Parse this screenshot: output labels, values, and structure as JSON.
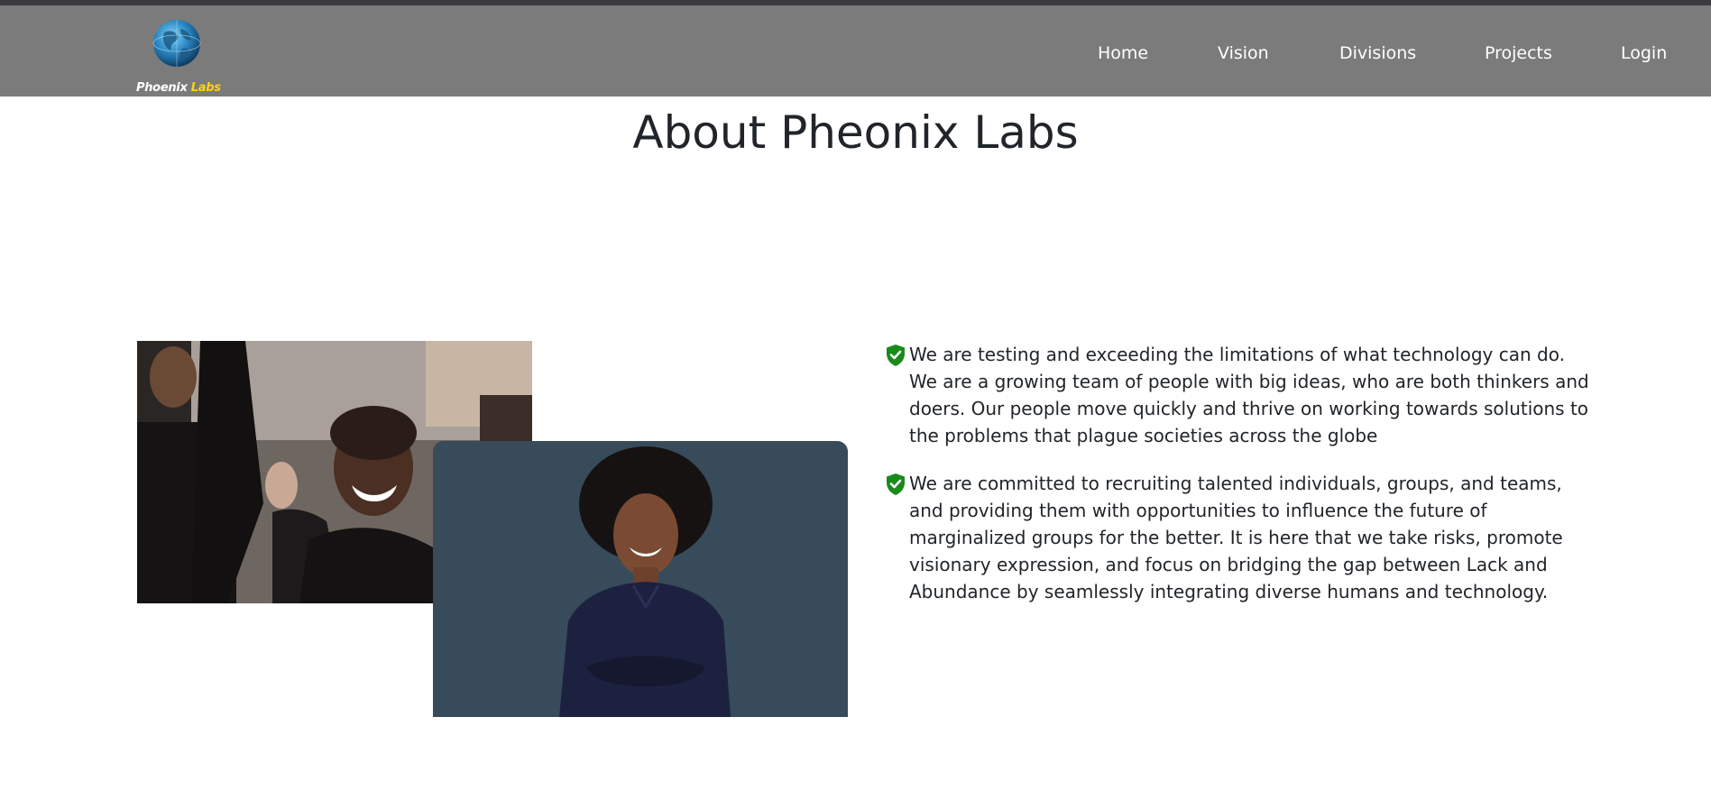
{
  "brand": {
    "name_part1": "Phoenix",
    "name_part2": "Labs",
    "accent": "#ffd400",
    "logo_icon": "globe-icon"
  },
  "nav": {
    "items": [
      {
        "label": "Home"
      },
      {
        "label": "Vision"
      },
      {
        "label": "Divisions"
      },
      {
        "label": "Projects"
      },
      {
        "label": "Login"
      }
    ],
    "background": "#7b7b7b"
  },
  "about": {
    "title": "About Pheonix Labs",
    "images": [
      {
        "name": "crowd-smiling-woman-photo"
      },
      {
        "name": "confident-woman-portrait-photo"
      }
    ],
    "points": [
      {
        "icon": "shield-check-icon",
        "text": "We are testing and exceeding the limitations of what technology can do. We are a growing team of people with big ideas, who are both thinkers and doers. Our people move quickly and thrive on working towards solutions to the problems that plague societies across the globe"
      },
      {
        "icon": "shield-check-icon",
        "text": "We are committed to recruiting talented individuals, groups, and teams, and providing them with opportunities to influence the future of marginalized groups for the better. It is here that we take risks, promote visionary expression, and focus on bridging the gap between Lack and Abundance by seamlessly integrating diverse humans and technology."
      }
    ],
    "icon_color": "#1a8a1a"
  }
}
